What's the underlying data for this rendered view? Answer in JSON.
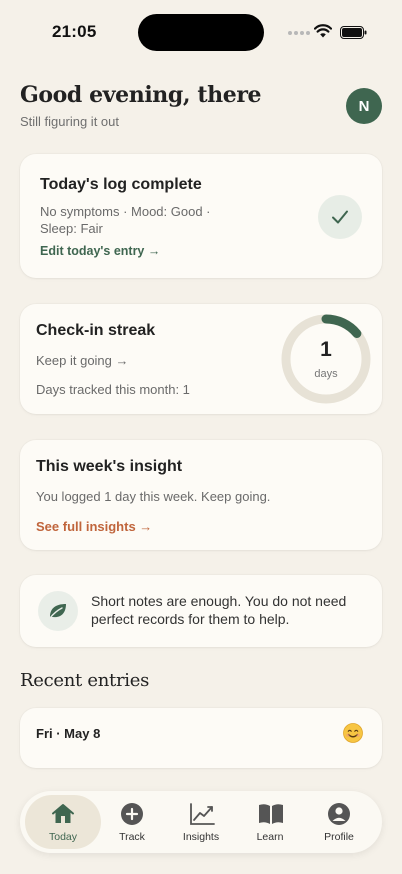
{
  "status": {
    "time": "21:05"
  },
  "header": {
    "greeting": "Good evening, there",
    "subtitle": "Still figuring it out",
    "avatar_initial": "N"
  },
  "log_card": {
    "title": "Today's log complete",
    "detail": "No symptoms · Mood: Good · Sleep: Fair",
    "edit_link": "Edit today's entry →"
  },
  "streak_card": {
    "title": "Check-in streak",
    "link": "Keep it going →",
    "month_text": "Days tracked this month: 1",
    "count": "1",
    "unit": "days",
    "ring_fraction": 0.14
  },
  "insight_card": {
    "title": "This week's insight",
    "text": "You logged 1 day this week. Keep going.",
    "link": "See full insights →"
  },
  "note_card": {
    "text": "Short notes are enough. You do not need perfect records for them to help."
  },
  "recent": {
    "title": "Recent entries",
    "entries": [
      {
        "date": "Fri · May 8",
        "mood_icon": "smiling-face-icon"
      }
    ]
  },
  "tabbar": {
    "items": [
      {
        "label": "Today",
        "icon": "home-icon",
        "active": true
      },
      {
        "label": "Track",
        "icon": "plus-circle-icon"
      },
      {
        "label": "Insights",
        "icon": "chart-icon"
      },
      {
        "label": "Learn",
        "icon": "book-icon"
      },
      {
        "label": "Profile",
        "icon": "person-icon"
      }
    ]
  },
  "colors": {
    "background": "#f5f1e9",
    "accent": "#3f6650",
    "link_orange": "#c0653c",
    "card": "#fdfbf6"
  }
}
